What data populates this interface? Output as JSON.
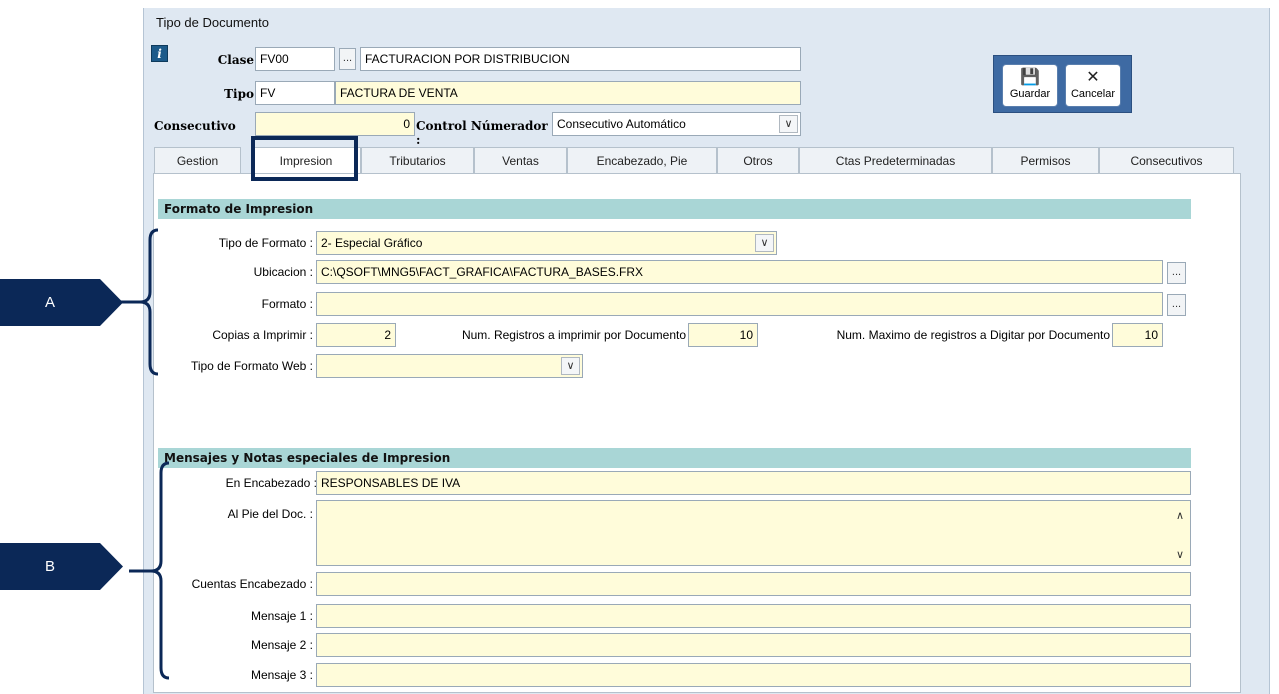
{
  "window": {
    "title": "Tipo de Documento"
  },
  "header": {
    "clase": {
      "label": "Clase",
      "code": "FV00",
      "description": "FACTURACION POR DISTRIBUCION"
    },
    "tipo": {
      "label": "Tipo",
      "code": "FV",
      "description": "FACTURA DE VENTA"
    },
    "consecutivo": {
      "label": "Consecutivo",
      "value": "0"
    },
    "control_numerador": {
      "label": "Control Númerador :",
      "value": "Consecutivo Automático"
    },
    "lookup_dots": "..."
  },
  "toolbar": {
    "guardar_label": "Guardar",
    "cancelar_label": "Cancelar"
  },
  "tabs": [
    {
      "label": "Gestion"
    },
    {
      "label": "Impresion"
    },
    {
      "label": "Tributarios"
    },
    {
      "label": "Ventas"
    },
    {
      "label": "Encabezado, Pie"
    },
    {
      "label": "Otros"
    },
    {
      "label": "Ctas Predeterminadas"
    },
    {
      "label": "Permisos"
    },
    {
      "label": "Consecutivos"
    }
  ],
  "formato": {
    "section_title": "Formato de Impresion",
    "tipo_formato": {
      "label": "Tipo de Formato :",
      "value": "2- Especial Gráfico"
    },
    "ubicacion": {
      "label": "Ubicacion :",
      "value": "C:\\QSOFT\\MNG5\\FACT_GRAFICA\\FACTURA_BASES.FRX"
    },
    "formato": {
      "label": "Formato :",
      "value": ""
    },
    "copias": {
      "label": "Copias a Imprimir :",
      "value": "2"
    },
    "num_registros": {
      "label": "Num. Registros a imprimir  por Documento",
      "value": "10"
    },
    "num_max": {
      "label": "Num. Maximo de registros a Digitar por Documento",
      "value": "10"
    },
    "tipo_formato_web": {
      "label": "Tipo de Formato Web :",
      "value": ""
    }
  },
  "mensajes": {
    "section_title": "Mensajes  y  Notas especiales de Impresion",
    "encabezado": {
      "label": "En Encabezado :",
      "value": "RESPONSABLES DE IVA"
    },
    "pie": {
      "label": "Al Pie del Doc. :",
      "value": ""
    },
    "cuentas": {
      "label": "Cuentas Encabezado :",
      "value": ""
    },
    "mensaje1": {
      "label": "Mensaje 1 :",
      "value": ""
    },
    "mensaje2": {
      "label": "Mensaje 2 :",
      "value": ""
    },
    "mensaje3": {
      "label": "Mensaje 3 :",
      "value": ""
    }
  },
  "annotations": {
    "a": "A",
    "b": "B"
  },
  "colors": {
    "callout": "#0b2857",
    "section": "#a9d6d6",
    "field": "#fffcda",
    "toolbar": "#3e6aa3"
  }
}
